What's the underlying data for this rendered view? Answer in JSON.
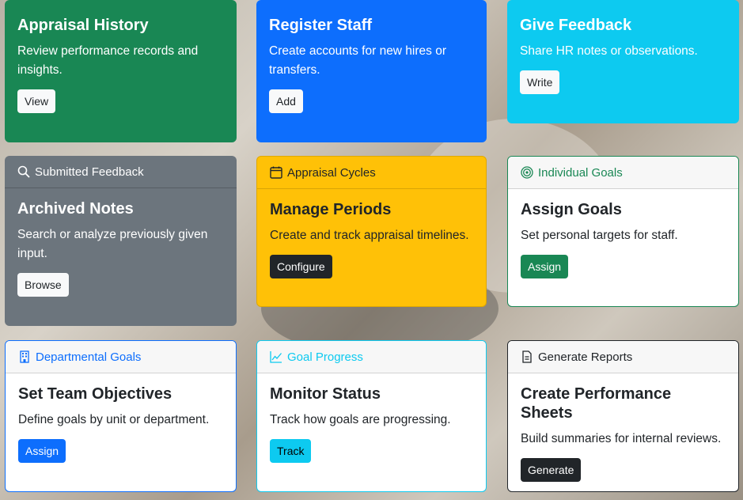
{
  "cards": {
    "appraisal_history": {
      "title": "Appraisal History",
      "text": "Review performance records and insights.",
      "button": "View"
    },
    "register_staff": {
      "title": "Register Staff",
      "text": "Create accounts for new hires or transfers.",
      "button": "Add"
    },
    "give_feedback": {
      "title": "Give Feedback",
      "text": "Share HR notes or observations.",
      "button": "Write"
    },
    "archived_notes": {
      "header": "Submitted Feedback",
      "header_icon": "search-icon",
      "title": "Archived Notes",
      "text": "Search or analyze previously given input.",
      "button": "Browse"
    },
    "manage_periods": {
      "header": "Appraisal Cycles",
      "header_icon": "calendar-icon",
      "title": "Manage Periods",
      "text": "Create and track appraisal timelines.",
      "button": "Configure"
    },
    "assign_goals": {
      "header": "Individual Goals",
      "header_icon": "target-icon",
      "title": "Assign Goals",
      "text": "Set personal targets for staff.",
      "button": "Assign"
    },
    "team_objectives": {
      "header": "Departmental Goals",
      "header_icon": "building-icon",
      "title": "Set Team Objectives",
      "text": "Define goals by unit or department.",
      "button": "Assign"
    },
    "monitor_status": {
      "header": "Goal Progress",
      "header_icon": "graph-up-icon",
      "title": "Monitor Status",
      "text": "Track how goals are progressing.",
      "button": "Track"
    },
    "performance_sheets": {
      "header": "Generate Reports",
      "header_icon": "document-icon",
      "title": "Create Performance Sheets",
      "text": "Build summaries for internal reviews.",
      "button": "Generate"
    }
  },
  "colors": {
    "green": "#198754",
    "blue": "#0d6efd",
    "cyan": "#0dcaf0",
    "gray": "#6c757d",
    "yellow": "#ffc107",
    "dark": "#212529"
  }
}
